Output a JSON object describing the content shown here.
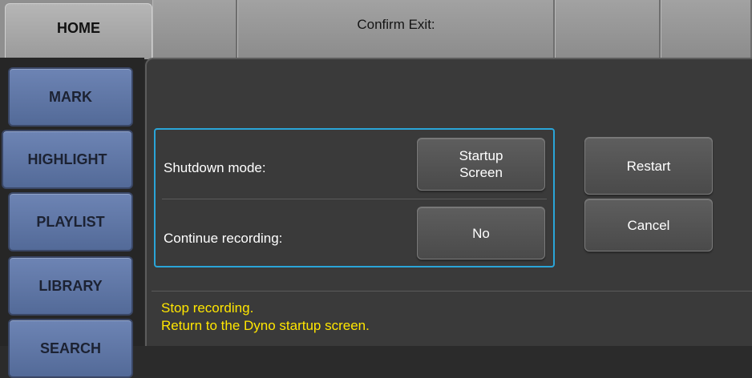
{
  "header": {
    "home_tab": "HOME",
    "title": "Confirm Exit:"
  },
  "nav": {
    "items": [
      {
        "label": "MARK"
      },
      {
        "label": "HIGHLIGHT"
      },
      {
        "label": "PLAYLIST"
      },
      {
        "label": "LIBRARY"
      },
      {
        "label": "SEARCH"
      }
    ]
  },
  "options": {
    "shutdown_mode": {
      "label": "Shutdown mode:",
      "value": "Startup Screen"
    },
    "continue_recording": {
      "label": "Continue recording:",
      "value": "No"
    }
  },
  "actions": {
    "restart": "Restart",
    "cancel": "Cancel"
  },
  "status": {
    "line1": "Stop recording.",
    "line2": "Return to the Dyno startup screen."
  },
  "colors": {
    "accent_border": "#2aa5d8",
    "nav_button": "#5f76a6",
    "status_text": "#ffe600"
  }
}
